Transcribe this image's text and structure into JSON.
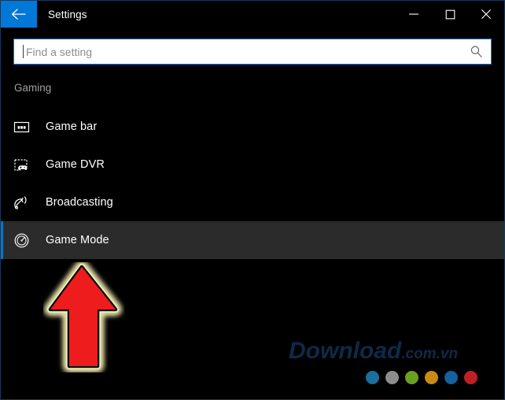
{
  "window": {
    "title": "Settings",
    "accent_color": "#0078d7",
    "background_color": "#000000",
    "selected_row_color": "#2b2b2b",
    "border_color": "#14395e"
  },
  "titlebar": {
    "back_icon": "back-arrow-icon",
    "minimize_label": "Minimize",
    "maximize_label": "Maximize",
    "close_label": "Close"
  },
  "search": {
    "placeholder": "Find a setting",
    "value": "",
    "icon": "search-icon"
  },
  "nav": {
    "section_header": "Gaming",
    "items": [
      {
        "label": "Game bar",
        "icon": "game-bar-icon",
        "selected": false
      },
      {
        "label": "Game DVR",
        "icon": "game-dvr-icon",
        "selected": false
      },
      {
        "label": "Broadcasting",
        "icon": "broadcasting-icon",
        "selected": false
      },
      {
        "label": "Game Mode",
        "icon": "game-mode-icon",
        "selected": true
      }
    ]
  },
  "annotation": {
    "arrow": {
      "direction": "up",
      "fill_color": "#ee1c1c",
      "outline_color": "#000000",
      "glow_color": "#f2edb0",
      "points_at": "Game Mode"
    }
  },
  "watermark": {
    "main": "Download",
    "suffix": ".com.vn",
    "color": "#0d2a47"
  },
  "dots": [
    {
      "name": "dot-teal",
      "color": "#1b6f9e"
    },
    {
      "name": "dot-gray",
      "color": "#8c8c8c"
    },
    {
      "name": "dot-green",
      "color": "#6aa022"
    },
    {
      "name": "dot-orange",
      "color": "#c98a16"
    },
    {
      "name": "dot-blue",
      "color": "#15609e"
    },
    {
      "name": "dot-red",
      "color": "#bf2026"
    }
  ]
}
